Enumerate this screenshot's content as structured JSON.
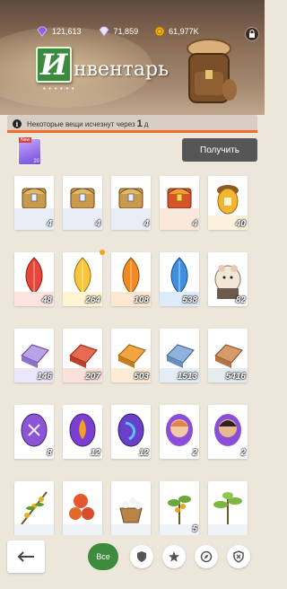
{
  "resources": {
    "amethyst": "121,613",
    "diamonds": "71,859",
    "coins": "61,977K"
  },
  "title": {
    "first_letter": "И",
    "rest": "нвентарь",
    "dots": "• • • • • •"
  },
  "notice": {
    "text": "Некоторые вещи исчезнут через",
    "number": "1",
    "unit": "д"
  },
  "claim": {
    "tag": "New",
    "count": "20",
    "button": "Получить"
  },
  "items": [
    {
      "name": "silver-chest",
      "count": "4"
    },
    {
      "name": "silver-chest",
      "count": "4"
    },
    {
      "name": "silver-chest",
      "count": "4"
    },
    {
      "name": "red-gold-chest",
      "count": "4"
    },
    {
      "name": "gold-acorn-chest",
      "count": "40"
    },
    {
      "name": "red-feather",
      "count": "48"
    },
    {
      "name": "yellow-feather",
      "count": "264"
    },
    {
      "name": "orange-feather",
      "count": "108"
    },
    {
      "name": "blue-feather",
      "count": "538"
    },
    {
      "name": "hamster-figure",
      "count": "82"
    },
    {
      "name": "purple-ingot",
      "count": "146"
    },
    {
      "name": "red-ingot",
      "count": "207"
    },
    {
      "name": "orange-ingot",
      "count": "503"
    },
    {
      "name": "blue-ingot",
      "count": "1513"
    },
    {
      "name": "grey-ingot",
      "count": "5416"
    },
    {
      "name": "purple-rune-egg",
      "count": "8"
    },
    {
      "name": "fire-rune-egg",
      "count": "12"
    },
    {
      "name": "blue-rune-egg",
      "count": "12"
    },
    {
      "name": "woman-portrait-token",
      "count": "2"
    },
    {
      "name": "man-portrait-token",
      "count": "2"
    },
    {
      "name": "olive-branch",
      "count": ""
    },
    {
      "name": "orange-fruits",
      "count": ""
    },
    {
      "name": "flower-basket",
      "count": ""
    },
    {
      "name": "orange-tree-seedling",
      "count": "5"
    },
    {
      "name": "green-plant",
      "count": ""
    }
  ],
  "footer": {
    "tab_all": "Все"
  },
  "colors": {
    "accent_orange": "#f36b2a",
    "tab_green": "#3d8b3d",
    "claim_button": "#565656"
  }
}
